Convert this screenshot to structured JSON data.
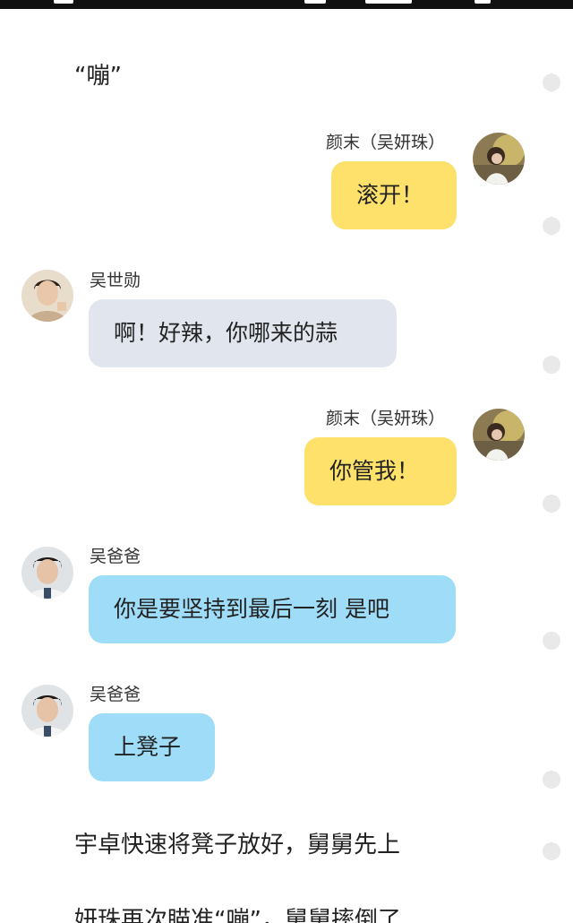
{
  "narration_top": "“嘣”",
  "messages": [
    {
      "sender": "颜末（吴妍珠）",
      "text": "滚开！",
      "side": "right",
      "color": "yellow"
    },
    {
      "sender": "吴世勋",
      "text": "啊！好辣，你哪来的蒜",
      "side": "left",
      "color": "gray"
    },
    {
      "sender": "颜末（吴妍珠）",
      "text": "你管我！",
      "side": "right",
      "color": "yellow"
    },
    {
      "sender": "吴爸爸",
      "text": "你是要坚持到最后一刻 是吧",
      "side": "left",
      "color": "blue"
    },
    {
      "sender": "吴爸爸",
      "text": "上凳子",
      "side": "left",
      "color": "blue"
    }
  ],
  "narration_bottom_1": "宇卓快速将凳子放好，舅舅先上",
  "narration_bottom_2": "妍珠再次瞄准“嘣”，舅舅摔倒了",
  "colors": {
    "yellow_bubble": "#fde16a",
    "gray_bubble": "#e1e6ee",
    "blue_bubble": "#9fdcf7"
  }
}
